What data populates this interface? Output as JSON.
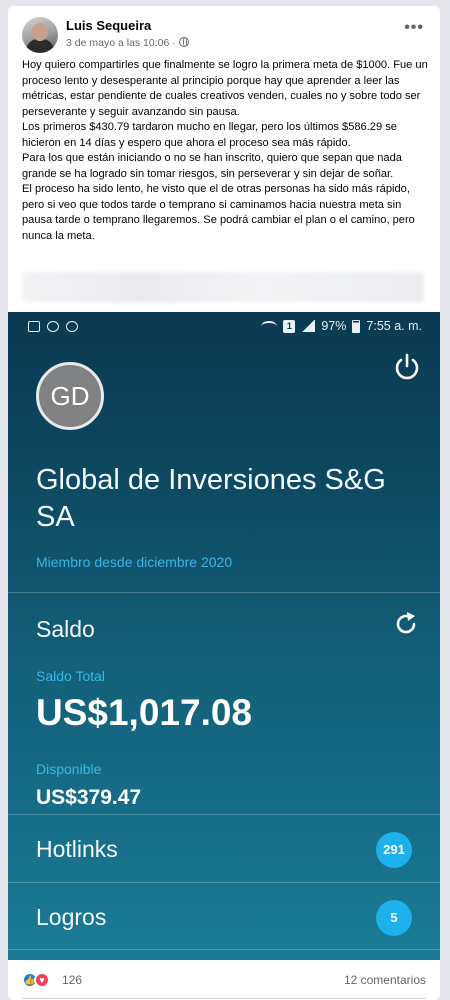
{
  "post": {
    "author": "Luis Sequeira",
    "date": "3 de mayo a las 10:06 ·",
    "more_label": "•••",
    "paragraphs": [
      "Hoy quiero compartirles que finalmente se logro la primera meta de $1000. Fue un proceso lento y desesperante al principio porque hay que aprender a leer las métricas, estar pendiente de cuales creativos venden, cuales no y sobre todo ser perseverante y seguir avanzando sin pausa.",
      "Los primeros $430.79 tardaron mucho en llegar, pero los últimos $586.29 se hicieron en 14 días y espero que ahora el proceso sea más rápido.",
      "Para los que están iniciando o no se han inscrito, quiero que sepan que nada grande se ha logrado sin tomar riesgos, sin perseverar y sin dejar de soñar.",
      "El proceso ha sido lento, he visto que el de otras personas ha sido más rápido, pero si veo que todos tarde o temprano si caminamos hacia nuestra meta sin pausa tarde o temprano llegaremos. Se podrá cambiar el plan o el camino, pero nunca la meta."
    ]
  },
  "phone": {
    "status": {
      "battery": "97%",
      "time": "7:55 a. m.",
      "sim": "1"
    },
    "avatar_initials": "GD",
    "company": "Global de Inversiones S&G SA",
    "member_since": "Miembro desde diciembre 2020",
    "saldo_label": "Saldo",
    "total_label": "Saldo Total",
    "total_value": "US$1,017.08",
    "available_label": "Disponible",
    "available_value": "US$379.47",
    "hotlinks": {
      "label": "Hotlinks",
      "count": "291"
    },
    "logros": {
      "label": "Logros",
      "count": "5"
    },
    "accent_color": "#1cb1ec"
  },
  "footer": {
    "reaction_count": "126",
    "comments": "12 comentarios"
  }
}
